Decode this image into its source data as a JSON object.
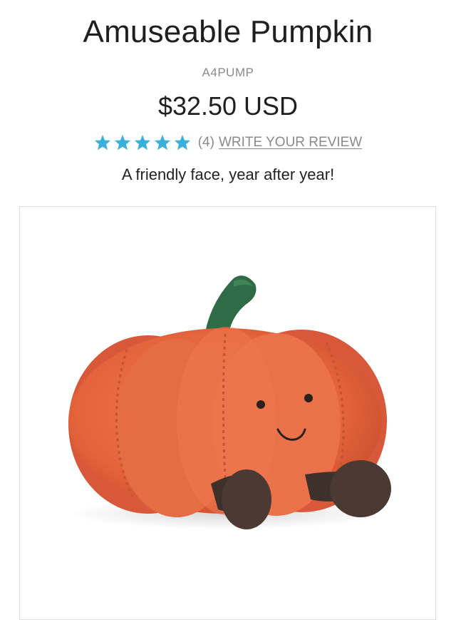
{
  "product": {
    "title": "Amuseable Pumpkin",
    "sku": "A4PUMP",
    "price": "$32.50 USD",
    "rating": {
      "stars": 5,
      "max": 5,
      "count_label": "(4)",
      "write_review_label": "WRITE YOUR REVIEW"
    },
    "tagline": "A friendly face, year after year!",
    "image_icon": "pumpkin-plush-image"
  },
  "colors": {
    "star": "#3bb0d9",
    "pumpkin": "#e8683f",
    "stem": "#2f6b46",
    "feet": "#4a3a33"
  }
}
